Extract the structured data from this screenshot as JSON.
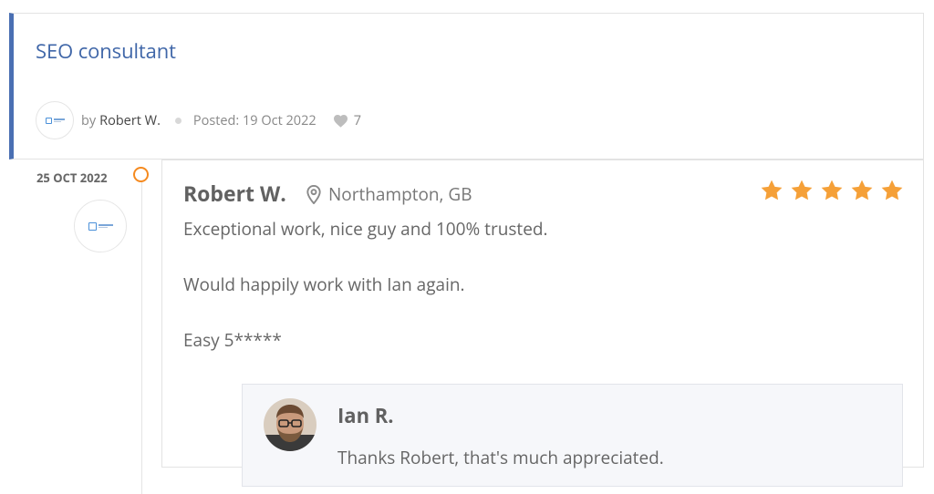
{
  "job": {
    "title": "SEO consultant",
    "by_label": "by",
    "author": "Robert W.",
    "posted": "Posted: 19 Oct 2022",
    "likes": "7"
  },
  "review": {
    "date": "25 OCT 2022",
    "reviewer": "Robert W.",
    "location": "Northampton, GB",
    "rating": 5,
    "paragraphs": [
      "Exceptional work, nice guy and 100% trusted.",
      "Would happily work with Ian again.",
      "Easy 5*****"
    ]
  },
  "reply": {
    "name": "Ian R.",
    "text": "Thanks Robert, that's much appreciated."
  },
  "colors": {
    "accent_blue": "#4a6fb3",
    "title_blue": "#3f66a8",
    "timeline_orange": "#f58a1f",
    "star_orange": "#f5a038"
  },
  "icons": {
    "location": "map-pin-icon",
    "likes": "heart-icon",
    "rating": "star-icon"
  }
}
